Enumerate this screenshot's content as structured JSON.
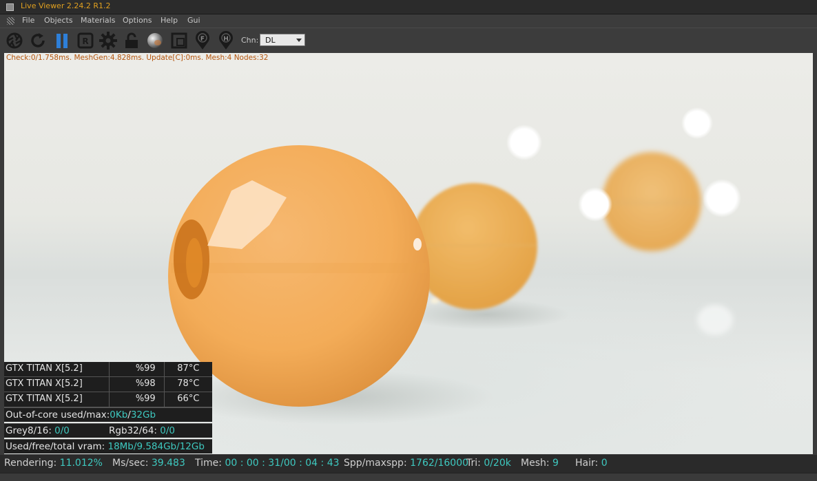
{
  "window": {
    "title": "Live Viewer 2.24.2 R1.2"
  },
  "menu": {
    "items": [
      "File",
      "Objects",
      "Materials",
      "Options",
      "Help",
      "Gui"
    ]
  },
  "toolbar": {
    "icons": [
      "aperture-icon",
      "refresh-icon",
      "pause-icon",
      "region-icon",
      "settings-gear-icon",
      "lock-icon",
      "material-sphere-icon",
      "focus-frame-icon",
      "pin-f-icon",
      "pin-h-icon"
    ],
    "channel_label": "Chn:",
    "channel_value": "DL"
  },
  "viewport": {
    "stats": "Check:0/1.758ms. MeshGen:4.828ms. Update[C]:0ms. Mesh:4 Nodes:32"
  },
  "gpus": [
    {
      "name": "GTX TITAN X[5.2]",
      "usage": "%99",
      "temp": "87°C"
    },
    {
      "name": "GTX TITAN X[5.2]",
      "usage": "%98",
      "temp": "78°C"
    },
    {
      "name": "GTX TITAN X[5.2]",
      "usage": "%99",
      "temp": "66°C"
    }
  ],
  "memory": {
    "ooc_label": "Out-of-core used/max:",
    "ooc_used": "0Kb",
    "ooc_sep": "/",
    "ooc_max": "32Gb",
    "grey_label": "Grey8/16:",
    "grey_value": "0/0",
    "rgb_label": "Rgb32/64:",
    "rgb_value": "0/0",
    "vram_label": "Used/free/total vram:",
    "vram_used": "18Mb",
    "vram_sep1": "/",
    "vram_free": "9.584Gb",
    "vram_sep2": "/",
    "vram_total": "12Gb"
  },
  "status": {
    "rendering_label": "Rendering:",
    "rendering_value": "11.012%",
    "ms_label": "Ms/sec:",
    "ms_value": "39.483",
    "time_label": "Time:",
    "time_value": "00 : 00 : 31/00 : 04 : 43",
    "spp_label": "Spp/maxspp:",
    "spp_value": "1762/16000",
    "tri_label": "Tri:",
    "tri_value": "0/20k",
    "mesh_label": "Mesh:",
    "mesh_value": "9",
    "hair_label": "Hair:",
    "hair_value": "0"
  },
  "colors": {
    "title_accent": "#e0a020",
    "stats_text": "#b5560e",
    "value_teal": "#3ec9c0",
    "sphere_orange": "#f0a850"
  }
}
